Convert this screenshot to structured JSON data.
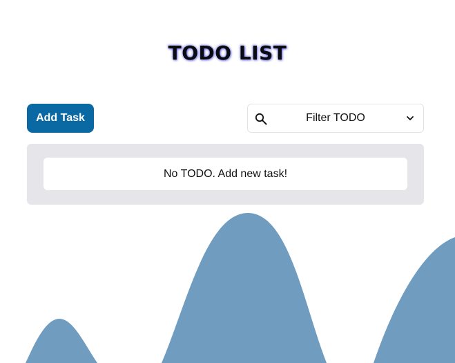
{
  "header": {
    "title": "TODO LIST"
  },
  "toolbar": {
    "add_label": "Add Task",
    "filter": {
      "selected": "Filter TODO",
      "icon": "search-icon",
      "dropdown_icon": "chevron-down-icon"
    }
  },
  "list": {
    "empty_message": "No TODO. Add new task!"
  },
  "colors": {
    "accent": "#0a68a3",
    "panel": "#e5e5ea",
    "wave": "#709cc0",
    "title_glow": "#4646dc"
  }
}
